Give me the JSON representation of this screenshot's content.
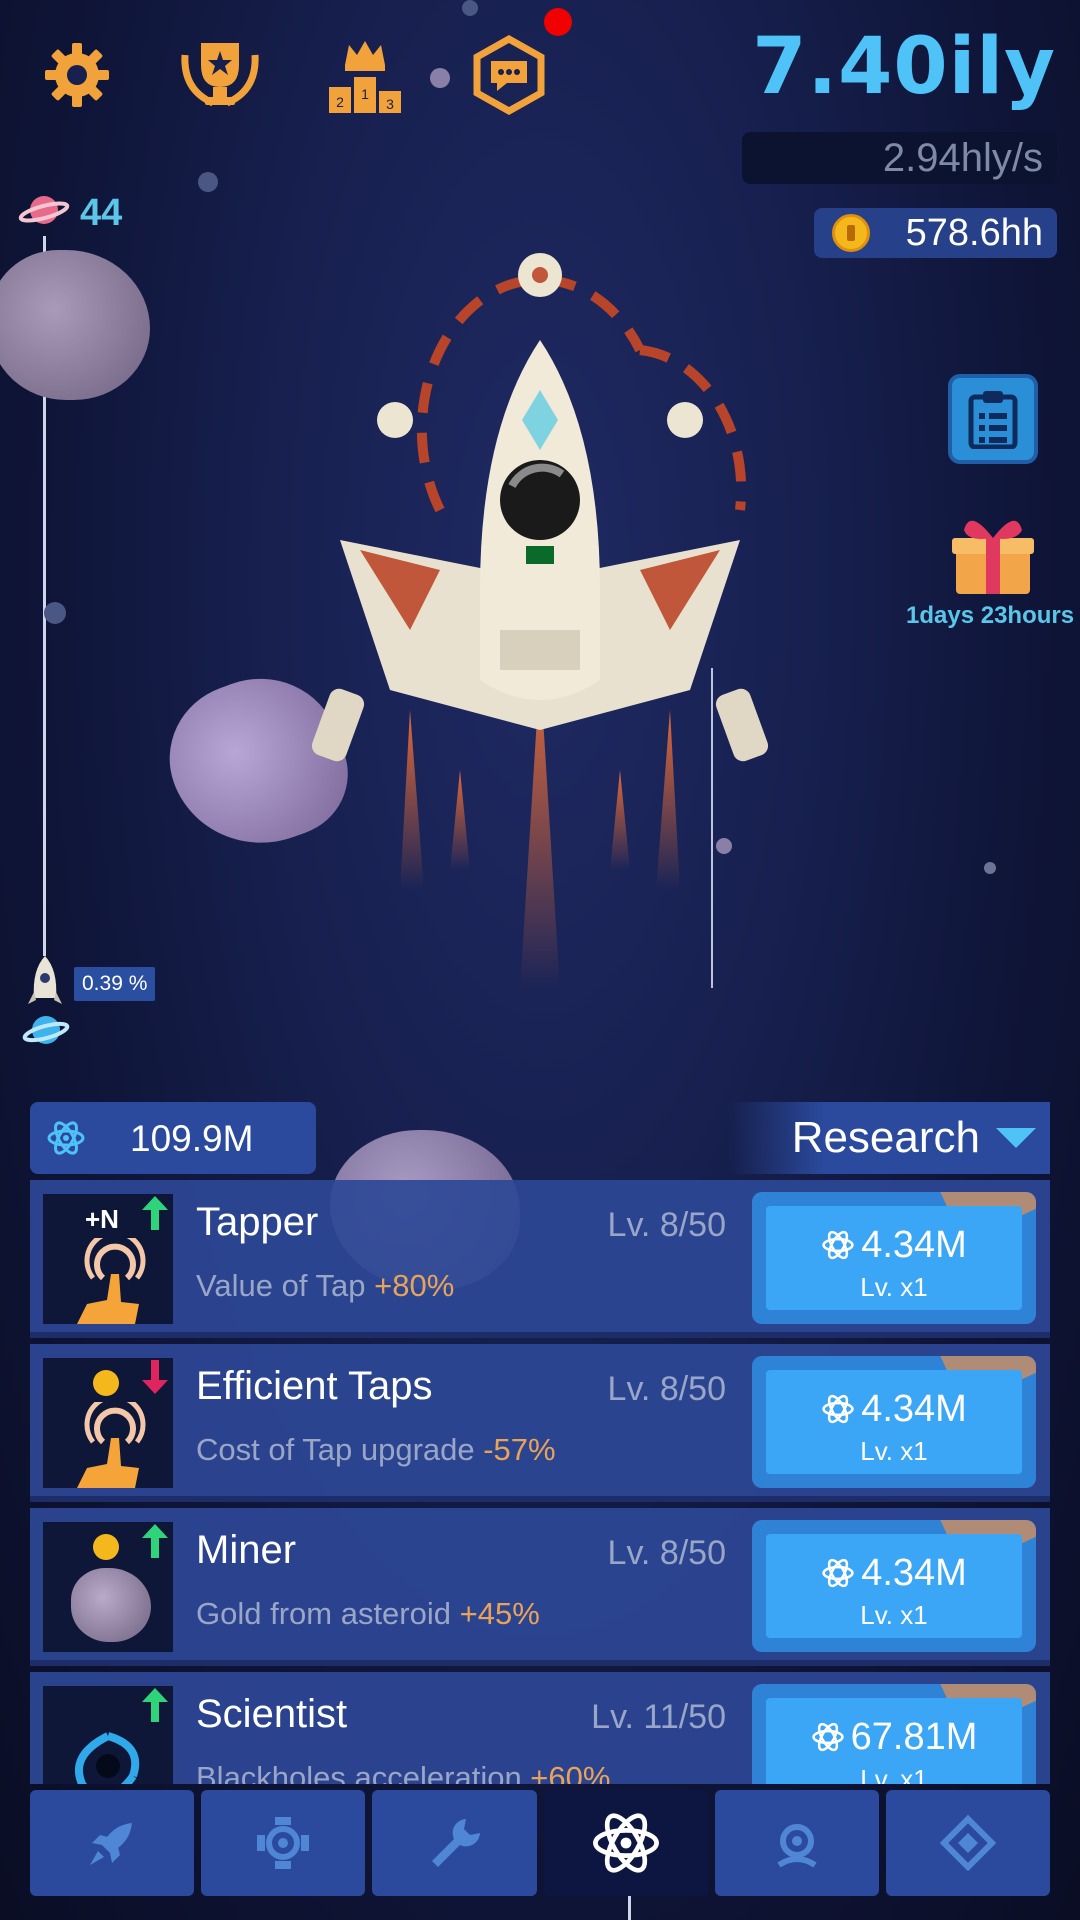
{
  "top_bar": {
    "icons": [
      "gear-icon",
      "trophy-icon",
      "leaderboard-podium-icon",
      "chat-hex-icon"
    ],
    "podium_labels": [
      "2",
      "1",
      "3"
    ]
  },
  "stats": {
    "distance": "7.40ily",
    "rate": "2.94hly/s",
    "gold": "578.6hh"
  },
  "progress": {
    "level": "44",
    "percent_label": "0.39 %",
    "percent": 0.39
  },
  "gift": {
    "timer": "1days 23hours"
  },
  "research_panel": {
    "resource_value": "109.9M",
    "tab_label": "Research",
    "items": [
      {
        "name": "Tapper",
        "level": "Lv. 8/50",
        "desc": "Value of Tap ",
        "bonus": "+80%",
        "cost": "4.34M",
        "lv_mult": "Lv. x1",
        "thumb_label": "+N",
        "trend": "up"
      },
      {
        "name": "Efficient Taps",
        "level": "Lv. 8/50",
        "desc": "Cost of Tap upgrade ",
        "bonus": "-57%",
        "cost": "4.34M",
        "lv_mult": "Lv. x1",
        "thumb_label": "",
        "trend": "down"
      },
      {
        "name": "Miner",
        "level": "Lv. 8/50",
        "desc": "Gold from asteroid ",
        "bonus": "+45%",
        "cost": "4.34M",
        "lv_mult": "Lv. x1",
        "thumb_label": "",
        "trend": "up"
      },
      {
        "name": "Scientist",
        "level": "Lv. 11/50",
        "desc": "Blackholes acceleration ",
        "bonus": "+60%",
        "cost": "67.81M",
        "lv_mult": "Lv. x1",
        "thumb_label": "",
        "trend": "up"
      }
    ]
  },
  "bottom_nav": [
    "rocket-icon",
    "drone-icon",
    "wrench-icon",
    "atom-icon",
    "headset-icon",
    "diamond-icon"
  ],
  "colors": {
    "accent": "#4fc3f7",
    "panel": "#2b4a9e",
    "bonus": "#e8a35a",
    "trend_up": "#2fd47a",
    "trend_down": "#e0245e"
  }
}
